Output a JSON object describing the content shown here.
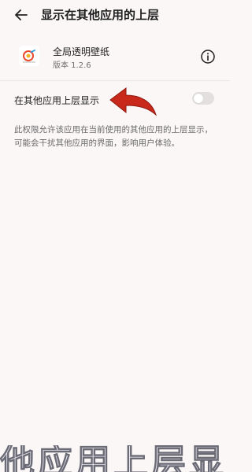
{
  "header": {
    "title": "显示在其他应用的上层"
  },
  "app": {
    "name": "全局透明壁纸",
    "version": "版本 1.2.6"
  },
  "permission": {
    "label": "在其他应用上层显示",
    "enabled": false,
    "description": "此权限允许该应用在当前使用的其他应用的上层显示，可能会干扰其他应用的界面，影响用户体验。"
  },
  "overlay": {
    "caption": "他应用上层显"
  },
  "colors": {
    "background": "#fbf7f7",
    "arrow": "#c8291b",
    "toggle_off": "#e3dfdf"
  },
  "icons": [
    "back-arrow-icon",
    "app-icon",
    "info-icon",
    "red-arrow-pointer"
  ]
}
